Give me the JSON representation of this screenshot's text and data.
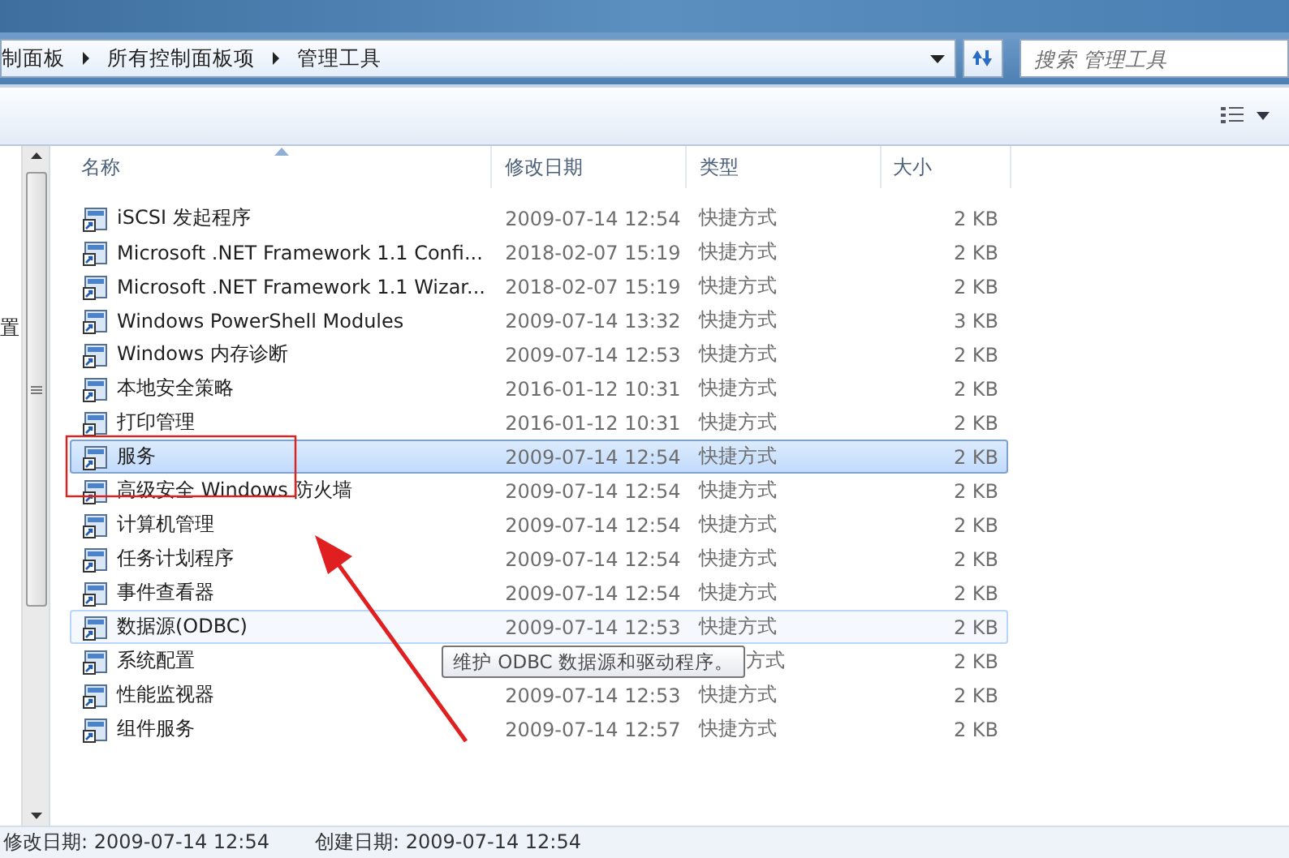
{
  "address_bar": {
    "crumbs": [
      "制面板",
      "所有控制面板项",
      "管理工具"
    ]
  },
  "search": {
    "placeholder": "搜索 管理工具"
  },
  "nav_pane": {
    "visible_text": "置"
  },
  "columns": [
    {
      "label": "名称",
      "sorted": true
    },
    {
      "label": "修改日期",
      "sorted": false
    },
    {
      "label": "类型",
      "sorted": false
    },
    {
      "label": "大小",
      "sorted": false
    }
  ],
  "rows": [
    {
      "name": "iSCSI 发起程序",
      "date": "2009-07-14 12:54",
      "type": "快捷方式",
      "size": "2 KB",
      "selected": false,
      "hovered": false,
      "covered": false
    },
    {
      "name": "Microsoft .NET Framework 1.1 Confi...",
      "date": "2018-02-07 15:19",
      "type": "快捷方式",
      "size": "2 KB",
      "selected": false,
      "hovered": false,
      "covered": false
    },
    {
      "name": "Microsoft .NET Framework 1.1 Wizar...",
      "date": "2018-02-07 15:19",
      "type": "快捷方式",
      "size": "2 KB",
      "selected": false,
      "hovered": false,
      "covered": false
    },
    {
      "name": "Windows PowerShell Modules",
      "date": "2009-07-14 13:32",
      "type": "快捷方式",
      "size": "3 KB",
      "selected": false,
      "hovered": false,
      "covered": false
    },
    {
      "name": "Windows 内存诊断",
      "date": "2009-07-14 12:53",
      "type": "快捷方式",
      "size": "2 KB",
      "selected": false,
      "hovered": false,
      "covered": false
    },
    {
      "name": "本地安全策略",
      "date": "2016-01-12 10:31",
      "type": "快捷方式",
      "size": "2 KB",
      "selected": false,
      "hovered": false,
      "covered": false
    },
    {
      "name": "打印管理",
      "date": "2016-01-12 10:31",
      "type": "快捷方式",
      "size": "2 KB",
      "selected": false,
      "hovered": false,
      "covered": false
    },
    {
      "name": "服务",
      "date": "2009-07-14 12:54",
      "type": "快捷方式",
      "size": "2 KB",
      "selected": true,
      "hovered": false,
      "covered": false
    },
    {
      "name": "高级安全 Windows 防火墙",
      "date": "2009-07-14 12:54",
      "type": "快捷方式",
      "size": "2 KB",
      "selected": false,
      "hovered": false,
      "covered": false
    },
    {
      "name": "计算机管理",
      "date": "2009-07-14 12:54",
      "type": "快捷方式",
      "size": "2 KB",
      "selected": false,
      "hovered": false,
      "covered": false
    },
    {
      "name": "任务计划程序",
      "date": "2009-07-14 12:54",
      "type": "快捷方式",
      "size": "2 KB",
      "selected": false,
      "hovered": false,
      "covered": false
    },
    {
      "name": "事件查看器",
      "date": "2009-07-14 12:54",
      "type": "快捷方式",
      "size": "2 KB",
      "selected": false,
      "hovered": false,
      "covered": false
    },
    {
      "name": "数据源(ODBC)",
      "date": "2009-07-14 12:53",
      "type": "快捷方式",
      "size": "2 KB",
      "selected": false,
      "hovered": true,
      "covered": false
    },
    {
      "name": "系统配置",
      "type": "方式",
      "size": "2 KB",
      "selected": false,
      "hovered": false,
      "covered": true
    },
    {
      "name": "性能监视器",
      "date": "2009-07-14 12:53",
      "type": "快捷方式",
      "size": "2 KB",
      "selected": false,
      "hovered": false,
      "covered": false
    },
    {
      "name": "组件服务",
      "date": "2009-07-14 12:57",
      "type": "快捷方式",
      "size": "2 KB",
      "selected": false,
      "hovered": false,
      "covered": false
    }
  ],
  "tooltip": {
    "text": "维护 ODBC 数据源和驱动程序。"
  },
  "status_bar": {
    "modified": "修改日期: 2009-07-14 12:54",
    "created": "创建日期: 2009-07-14 12:54"
  }
}
